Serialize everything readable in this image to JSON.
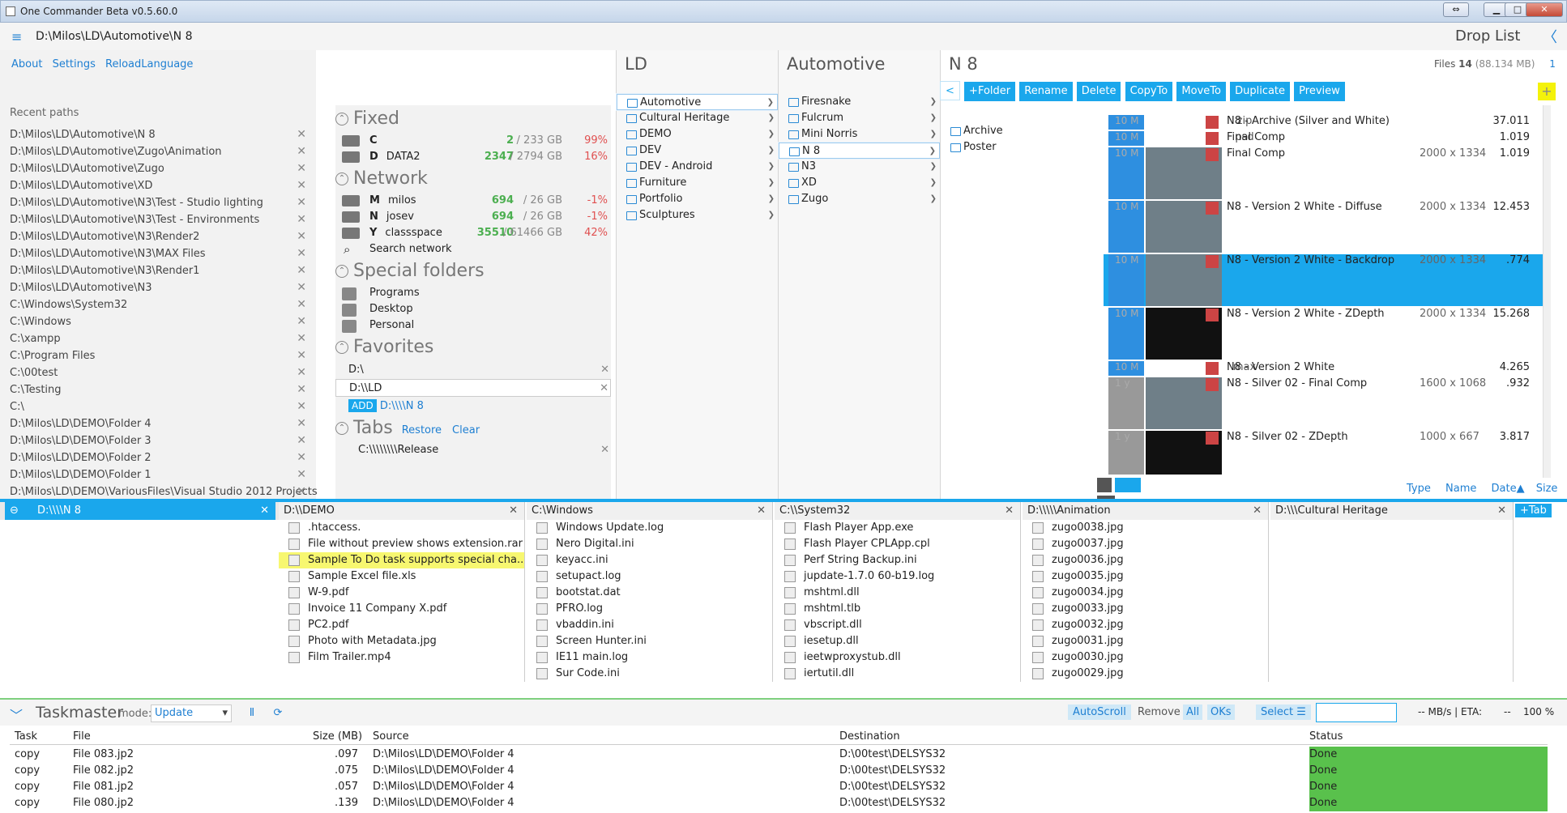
{
  "window": {
    "title": "One Commander Beta v0.5.60.0"
  },
  "path": {
    "current": "D:\\Milos\\LD\\Automotive\\N 8",
    "drop_list": "Drop List"
  },
  "menu": {
    "about": "About",
    "settings": "Settings",
    "reload": "ReloadLanguage"
  },
  "recent": {
    "label": "Recent paths",
    "items": [
      "D:\\Milos\\LD\\Automotive\\N 8",
      "D:\\Milos\\LD\\Automotive\\Zugo\\Animation",
      "D:\\Milos\\LD\\Automotive\\Zugo",
      "D:\\Milos\\LD\\Automotive\\XD",
      "D:\\Milos\\LD\\Automotive\\N3\\Test - Studio lighting",
      "D:\\Milos\\LD\\Automotive\\N3\\Test - Environments",
      "D:\\Milos\\LD\\Automotive\\N3\\Render2",
      "D:\\Milos\\LD\\Automotive\\N3\\MAX Files",
      "D:\\Milos\\LD\\Automotive\\N3\\Render1",
      "D:\\Milos\\LD\\Automotive\\N3",
      "C:\\Windows\\System32",
      "C:\\Windows",
      "C:\\xampp",
      "C:\\Program Files",
      "C:\\00test",
      "C:\\Testing",
      "C:\\",
      "D:\\Milos\\LD\\DEMO\\Folder 4",
      "D:\\Milos\\LD\\DEMO\\Folder 3",
      "D:\\Milos\\LD\\DEMO\\Folder 2",
      "D:\\Milos\\LD\\DEMO\\Folder 1",
      "D:\\Milos\\LD\\DEMO\\VariousFiles\\Visual Studio 2012 Projects"
    ]
  },
  "fixed": {
    "label": "Fixed",
    "drives": [
      {
        "letter": "C",
        "name": "",
        "free": "2",
        "total": "/ 233 GB",
        "pct": "99%"
      },
      {
        "letter": "D",
        "name": "DATA2",
        "free": "2347",
        "total": "/ 2794 GB",
        "pct": "16%"
      }
    ]
  },
  "network": {
    "label": "Network",
    "drives": [
      {
        "letter": "M",
        "name": "milos",
        "free": "694",
        "total": "/ 26 GB",
        "pct": "-1%"
      },
      {
        "letter": "N",
        "name": "josev",
        "free": "694",
        "total": "/ 26 GB",
        "pct": "-1%"
      },
      {
        "letter": "Y",
        "name": "classspace",
        "free": "35510",
        "total": "/ 61466 GB",
        "pct": "42%"
      }
    ],
    "search": "Search network"
  },
  "special": {
    "label": "Special folders",
    "items": [
      "Programs",
      "Desktop",
      "Personal"
    ]
  },
  "favorites": {
    "label": "Favorites",
    "items": [
      "D:\\",
      "D:\\\\LD"
    ],
    "add": "ADD",
    "add_path": "D:\\\\\\\\N 8"
  },
  "tabs_section": {
    "label": "Tabs",
    "restore": "Restore",
    "clear": "Clear",
    "item": "C:\\\\\\\\\\\\\\\\Release"
  },
  "col1": {
    "title": "LD",
    "items": [
      "Automotive",
      "Cultural Heritage",
      "DEMO",
      "DEV",
      "DEV - Android",
      "Furniture",
      "Portfolio",
      "Sculptures"
    ]
  },
  "col2": {
    "title": "Automotive",
    "items": [
      "Firesnake",
      "Fulcrum",
      "Mini Norris",
      "N 8",
      "N3",
      "XD",
      "Zugo"
    ]
  },
  "col3": {
    "title": "N 8",
    "files_label": "Files",
    "files_count": "14",
    "files_size": "(88.134 MB)",
    "page": "1",
    "items": [
      "Archive",
      "Poster"
    ]
  },
  "toolbar": {
    "back": "<",
    "folder": "+Folder",
    "rename": "Rename",
    "delete": "Delete",
    "copyto": "CopyTo",
    "moveto": "MoveTo",
    "duplicate": "Duplicate",
    "preview": "Preview"
  },
  "files": [
    {
      "age": "10 M",
      "ext": "zip",
      "name": "N8 - Archive (Silver and White)",
      "dim": "",
      "size": "37.011"
    },
    {
      "age": "10 M",
      "ext": "psd",
      "name": "Final Comp",
      "dim": "",
      "size": "1.019"
    },
    {
      "age": "10 M",
      "ext": "",
      "name": "Final Comp",
      "dim": "2000 x 1334",
      "size": "1.019"
    },
    {
      "age": "10 M",
      "ext": "",
      "name": "N8 - Version 2 White - Diffuse",
      "dim": "2000 x 1334",
      "size": "12.453"
    },
    {
      "age": "10 M",
      "ext": "",
      "name": "N8 - Version 2 White - Backdrop",
      "dim": "2000 x 1334",
      "size": ".774"
    },
    {
      "age": "10 M",
      "ext": "",
      "name": "N8 - Version 2 White - ZDepth",
      "dim": "2000 x 1334",
      "size": "15.268"
    },
    {
      "age": "10 M",
      "ext": "max",
      "name": "N8 - Version 2 White",
      "dim": "",
      "size": "4.265"
    },
    {
      "age": "1 y",
      "ext": "",
      "name": "N8 - Silver 02 - Final Comp",
      "dim": "1600 x 1068",
      "size": ".932"
    },
    {
      "age": "1 y",
      "ext": "",
      "name": "N8 - Silver 02 - ZDepth",
      "dim": "1000 x 667",
      "size": "3.817"
    }
  ],
  "sort": {
    "type": "Type",
    "name": "Name",
    "date": "Date▲",
    "size": "Size"
  },
  "tabbar": {
    "active": "D:\\\\\\\\N 8",
    "add": "+Tab"
  },
  "panels": [
    {
      "title": "D:\\\\DEMO",
      "files": [
        ".htaccess.",
        "File without preview shows extension.rar",
        "Sample To Do task supports special cha...",
        "Sample Excel file.xls",
        "W-9.pdf",
        "Invoice 11 Company X.pdf",
        "PC2.pdf",
        "Photo with Metadata.jpg",
        "Film Trailer.mp4"
      ]
    },
    {
      "title": "C:\\Windows",
      "files": [
        "Windows Update.log",
        "Nero Digital.ini",
        "keyacc.ini",
        "setupact.log",
        "bootstat.dat",
        "PFRO.log",
        "vbaddin.ini",
        "Screen Hunter.ini",
        "IE11 main.log",
        "Sur Code.ini"
      ]
    },
    {
      "title": "C:\\\\System32",
      "files": [
        "Flash Player App.exe",
        "Flash Player CPLApp.cpl",
        "Perf String Backup.ini",
        "jupdate-1.7.0 60-b19.log",
        "mshtml.dll",
        "mshtml.tlb",
        "vbscript.dll",
        "iesetup.dll",
        "ieetwproxystub.dll",
        "iertutil.dll"
      ]
    },
    {
      "title": "D:\\\\\\\\\\Animation",
      "files": [
        "zugo0038.jpg",
        "zugo0037.jpg",
        "zugo0036.jpg",
        "zugo0035.jpg",
        "zugo0034.jpg",
        "zugo0033.jpg",
        "zugo0032.jpg",
        "zugo0031.jpg",
        "zugo0030.jpg",
        "zugo0029.jpg"
      ]
    },
    {
      "title": "D:\\\\\\Cultural Heritage",
      "files": []
    }
  ],
  "taskmaster": {
    "title": "Taskmaster",
    "mode_label": "mode:",
    "mode": "Update",
    "autoscroll": "AutoScroll",
    "remove": "Remove",
    "all": "All",
    "oks": "OKs",
    "select": "Select",
    "rate": "-- MB/s | ETA:",
    "eta": "--",
    "pct": "100 %"
  },
  "grid": {
    "headers": [
      "Task",
      "File",
      "Size (MB)",
      "Source",
      "Destination",
      "Status"
    ],
    "rows": [
      [
        "copy",
        "File 083.jp2",
        ".097",
        "D:\\Milos\\LD\\DEMO\\Folder 4",
        "D:\\00test\\DELSYS32",
        "Done"
      ],
      [
        "copy",
        "File 082.jp2",
        ".075",
        "D:\\Milos\\LD\\DEMO\\Folder 4",
        "D:\\00test\\DELSYS32",
        "Done"
      ],
      [
        "copy",
        "File 081.jp2",
        ".057",
        "D:\\Milos\\LD\\DEMO\\Folder 4",
        "D:\\00test\\DELSYS32",
        "Done"
      ],
      [
        "copy",
        "File 080.jp2",
        ".139",
        "D:\\Milos\\LD\\DEMO\\Folder 4",
        "D:\\00test\\DELSYS32",
        "Done"
      ]
    ]
  }
}
